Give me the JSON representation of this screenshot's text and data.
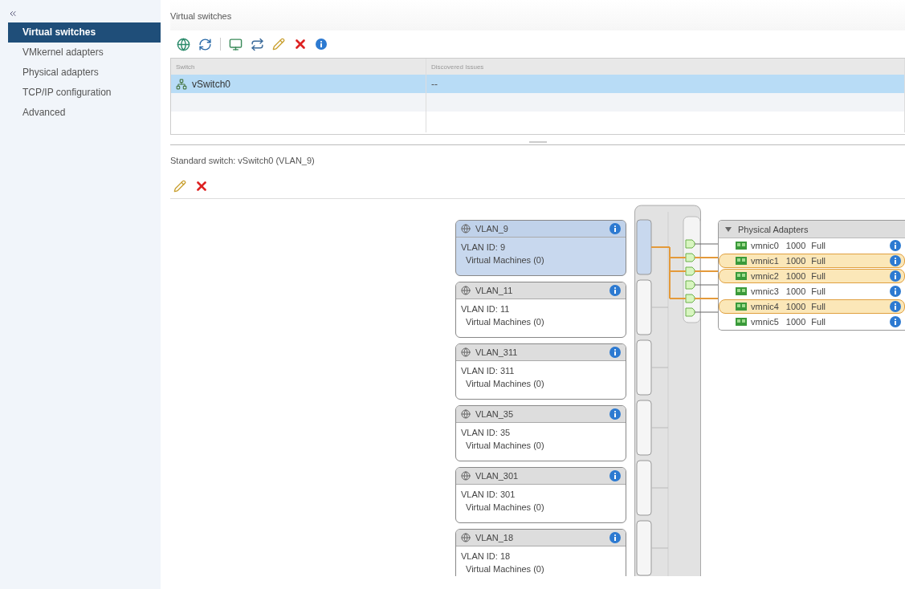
{
  "sidebar": {
    "items": [
      {
        "label": "Virtual switches",
        "selected": true
      },
      {
        "label": "VMkernel adapters",
        "selected": false
      },
      {
        "label": "Physical adapters",
        "selected": false
      },
      {
        "label": "TCP/IP configuration",
        "selected": false
      },
      {
        "label": "Advanced",
        "selected": false
      }
    ]
  },
  "virtual_switches": {
    "title": "Virtual switches",
    "table": {
      "columns": [
        "Switch",
        "Discovered Issues"
      ],
      "rows": [
        {
          "switch": "vSwitch0",
          "issues": "--",
          "selected": true
        }
      ]
    }
  },
  "details": {
    "title": "Standard switch: vSwitch0 (VLAN_9)",
    "port_groups": [
      {
        "name": "VLAN_9",
        "vlan_id": "VLAN ID: 9",
        "vms": "Virtual Machines (0)",
        "selected": true
      },
      {
        "name": "VLAN_11",
        "vlan_id": "VLAN ID: 11",
        "vms": "Virtual Machines (0)",
        "selected": false
      },
      {
        "name": "VLAN_311",
        "vlan_id": "VLAN ID: 311",
        "vms": "Virtual Machines (0)",
        "selected": false
      },
      {
        "name": "VLAN_35",
        "vlan_id": "VLAN ID: 35",
        "vms": "Virtual Machines (0)",
        "selected": false
      },
      {
        "name": "VLAN_301",
        "vlan_id": "VLAN ID: 301",
        "vms": "Virtual Machines (0)",
        "selected": false
      },
      {
        "name": "VLAN_18",
        "vlan_id": "VLAN ID: 18",
        "vms": "Virtual Machines (0)",
        "selected": false
      }
    ],
    "adapters": {
      "title": "Physical Adapters",
      "expanded": true,
      "items": [
        {
          "name": "vmnic0",
          "speed": "1000",
          "duplex": "Full",
          "active": false
        },
        {
          "name": "vmnic1",
          "speed": "1000",
          "duplex": "Full",
          "active": true
        },
        {
          "name": "vmnic2",
          "speed": "1000",
          "duplex": "Full",
          "active": true
        },
        {
          "name": "vmnic3",
          "speed": "1000",
          "duplex": "Full",
          "active": false
        },
        {
          "name": "vmnic4",
          "speed": "1000",
          "duplex": "Full",
          "active": true
        },
        {
          "name": "vmnic5",
          "speed": "1000",
          "duplex": "Full",
          "active": false
        }
      ]
    }
  }
}
